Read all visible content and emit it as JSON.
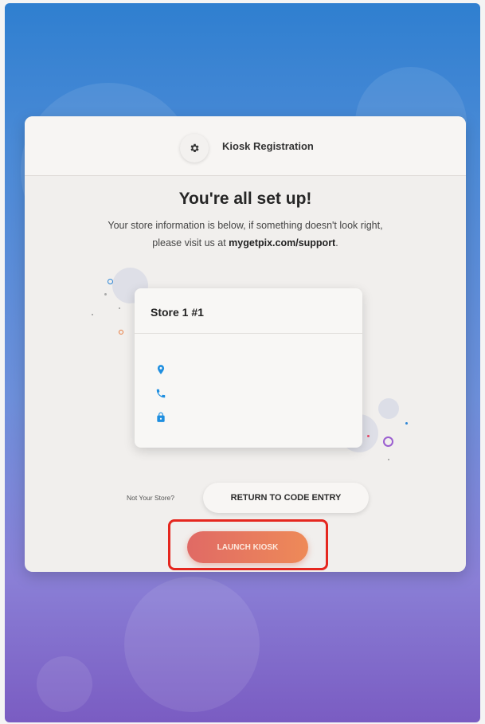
{
  "header": {
    "title": "Kiosk Registration",
    "icon": "gear-icon"
  },
  "main": {
    "heading": "You're all set up!",
    "subtitle_line1": "Your store information is below, if something doesn't look right,",
    "subtitle_line2_prefix": "please visit us at ",
    "subtitle_link": "mygetpix.com/support",
    "subtitle_line2_suffix": "."
  },
  "store_card": {
    "name": "Store 1 #1",
    "icons": [
      "location-pin-icon",
      "phone-icon",
      "lock-icon"
    ]
  },
  "actions": {
    "not_your_store": "Not Your Store?",
    "return_label": "RETURN TO CODE ENTRY",
    "launch_label": "LAUNCH KIOSK"
  },
  "colors": {
    "accent_blue": "#1f8fe0",
    "launch_gradient_start": "#e06a65",
    "launch_gradient_end": "#ee8a58",
    "highlight": "#e5271f"
  }
}
